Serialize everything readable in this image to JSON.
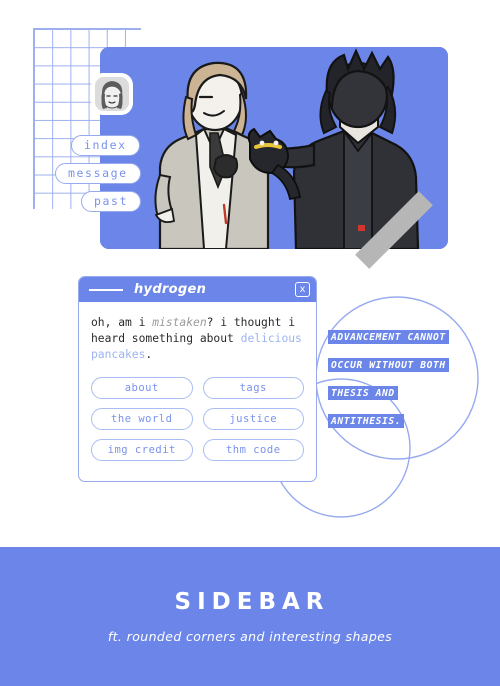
{
  "theme": {
    "accent": "#6b86e8",
    "accent_light": "#97aaee",
    "text_blue": "#7b92ec",
    "gray_bar": "#b6b6b6",
    "body_text": "#2b2b2b",
    "muted": "#9a9a9a",
    "link": "#9db3f2",
    "background": "#ffffff"
  },
  "collage": {
    "avatar_alt": "avatar",
    "nav": [
      {
        "label": "index"
      },
      {
        "label": "message"
      },
      {
        "label": "past"
      }
    ]
  },
  "quote": {
    "lines": [
      "ADVANCEMENT CANNOT",
      "OCCUR WITHOUT BOTH",
      "THESIS AND",
      "ANTITHESIS."
    ]
  },
  "window": {
    "title": "hydrogen",
    "close_label": "x",
    "message": {
      "part1": "oh, am i ",
      "emphasis": "mistaken",
      "part2": "? i thought i heard something about ",
      "link": "delicious pancakes",
      "part3": "."
    },
    "buttons": [
      {
        "label": "about"
      },
      {
        "label": "tags"
      },
      {
        "label": "the world"
      },
      {
        "label": "justice"
      },
      {
        "label": "img credit"
      },
      {
        "label": "thm code"
      }
    ]
  },
  "band": {
    "title": "SIDEBAR",
    "subtitle": "ft. rounded corners and interesting shapes"
  }
}
